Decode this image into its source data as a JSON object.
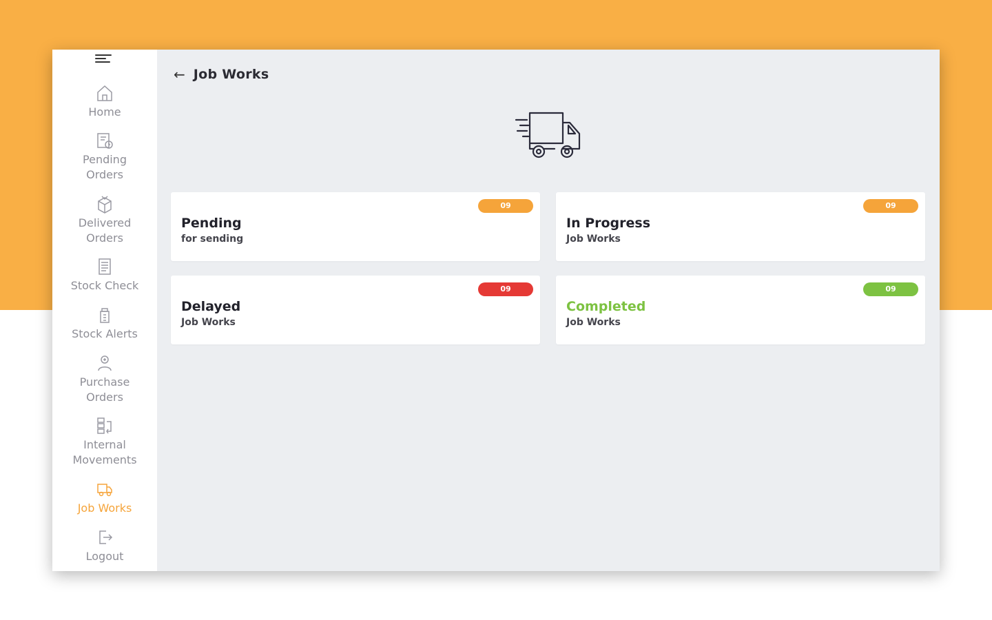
{
  "page": {
    "title": "Job Works"
  },
  "sidebar": {
    "items": [
      {
        "label_line1": "Home",
        "label_line2": "",
        "icon": "home-icon"
      },
      {
        "label_line1": "Pending",
        "label_line2": "Orders",
        "icon": "pending-orders-icon"
      },
      {
        "label_line1": "Delivered",
        "label_line2": "Orders",
        "icon": "delivered-orders-icon"
      },
      {
        "label_line1": "Stock Check",
        "label_line2": "",
        "icon": "stock-check-icon"
      },
      {
        "label_line1": "Stock Alerts",
        "label_line2": "",
        "icon": "stock-alerts-icon"
      },
      {
        "label_line1": "Purchase",
        "label_line2": "Orders",
        "icon": "purchase-orders-icon"
      },
      {
        "label_line1": "Internal",
        "label_line2": "Movements",
        "icon": "internal-movements-icon"
      },
      {
        "label_line1": "Job Works",
        "label_line2": "",
        "icon": "job-works-icon",
        "active": true
      },
      {
        "label_line1": "Logout",
        "label_line2": "",
        "icon": "logout-icon"
      }
    ]
  },
  "cards": [
    {
      "title": "Pending",
      "subtitle": "for sending",
      "badge": "09",
      "badge_color": "#F5A43A",
      "title_color": "#22222b"
    },
    {
      "title": "In Progress",
      "subtitle": "Job Works",
      "badge": "09",
      "badge_color": "#F5A43A",
      "title_color": "#22222b"
    },
    {
      "title": "Delayed",
      "subtitle": "Job Works",
      "badge": "09",
      "badge_color": "#E53935",
      "title_color": "#22222b"
    },
    {
      "title": "Completed",
      "subtitle": "Job Works",
      "badge": "09",
      "badge_color": "#7DC242",
      "title_color": "#7DC242"
    }
  ],
  "colors": {
    "accent": "#F9AF45",
    "active_nav": "#F5A43A"
  }
}
